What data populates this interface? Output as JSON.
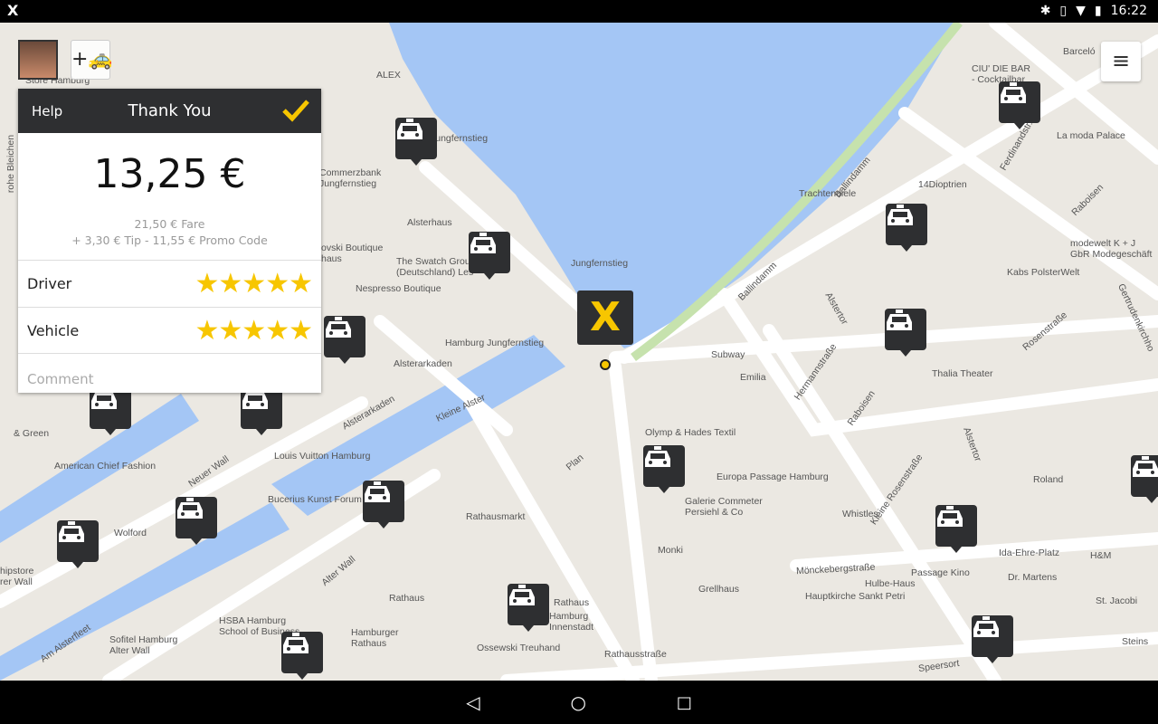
{
  "status_bar": {
    "app_icon": "mytaxi-x-icon",
    "time": "16:22",
    "icons": [
      "bluetooth-icon",
      "vibrate-icon",
      "wifi-icon",
      "battery-icon"
    ]
  },
  "map": {
    "labels": [
      "ALEX",
      "Jungfernstieg",
      "Commerzbank\nJungfernstieg",
      "Alsterhaus",
      "ovski Boutique\nhaus",
      "The Swatch Grou\n(Deutschland) Les",
      "Nespresso Boutique",
      "Jungfernstieg",
      "Hamburg Jungfernstieg",
      "Alsterarkaden",
      "Kleine Alster",
      "Alsterarkaden",
      "Neuer Wall",
      "Louis Vuitton Hamburg",
      "American Chief Fashion",
      "& Green",
      "Bucerius Kunst Forum",
      "Rathausmarkt",
      "Wolford",
      "Alter Wall",
      "Rathaus",
      "HSBA Hamburg\nSchool of Business",
      "Sofitel Hamburg\nAlter Wall",
      "Hamburger\nRathaus",
      "Rathaus",
      "Hamburg\nInnenstadt",
      "Ossewski Treuhand",
      "Rathausstraße",
      "Monki",
      "Galerie Commeter\nPersiehl & Co",
      "Europa Passage Hamburg",
      "Olymp & Hades Textil",
      "Plan",
      "Subway",
      "Emilia",
      "Hermannstraße",
      "Ballindamm",
      "Ballindamm",
      "Alstertor",
      "Raboisen",
      "Thalia Theater",
      "Rosenstraße",
      "Kabs PolsterWelt",
      "modewelt K + J\nGbR Modegeschäft",
      "14Dioptrien",
      "Trachtendiele",
      "La moda Palace",
      "CIU' DIE BAR\n- Cocktailbar",
      "Barceló",
      "Ferdinandstr.",
      "Raboisen",
      "Kleine Rosenstraße",
      "Whistles",
      "Roland",
      "Mönckebergstraße",
      "Passage Kino",
      "Ida-Ehre-Platz",
      "Dr. Martens",
      "H&M",
      "Hulbe-Haus",
      "Grellhaus",
      "Hauptkirche Sankt Petri",
      "St. Jacobi",
      "Speersort",
      "Steins",
      "Am Alsterfleet",
      "hipstore\nrer Wall",
      "Store Hamburg",
      "rohe Bleichen",
      "Gertrudenkirchho",
      "Alstertor"
    ],
    "taxi_count": 17
  },
  "account": {
    "avatar": "user-avatar",
    "add_taxi_icon": "add-taxi-icon"
  },
  "menu_icon": "hamburger-menu-icon",
  "panel": {
    "help": "Help",
    "title": "Thank You",
    "confirm_icon": "checkmark-icon",
    "amount": "13,25 €",
    "fare_line": "21,50 € Fare",
    "extras_line": "+ 3,30 € Tip - 11,55 € Promo Code",
    "ratings": [
      {
        "label": "Driver",
        "stars": 5,
        "max": 5
      },
      {
        "label": "Vehicle",
        "stars": 5,
        "max": 5
      }
    ],
    "comment_placeholder": "Comment"
  },
  "nav": {
    "back": "back-icon",
    "home": "home-icon",
    "recents": "recents-icon"
  },
  "colors": {
    "accent": "#f7c600",
    "header": "#2e2f31",
    "water": "#a4c6f5",
    "land": "#ebe8e2"
  }
}
